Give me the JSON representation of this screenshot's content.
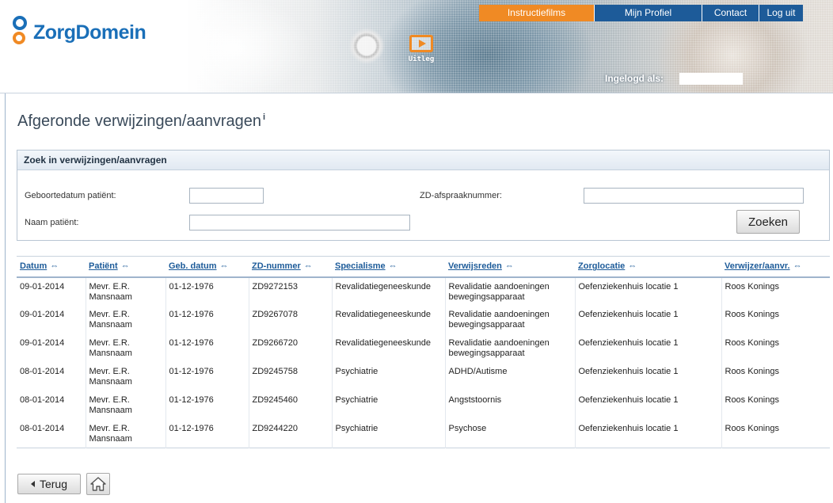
{
  "brand": {
    "name": "ZorgDomein"
  },
  "header": {
    "uitleg_label": "Uitleg",
    "nav": {
      "films": "Instructiefilms",
      "profiel": "Mijn Profiel",
      "contact": "Contact",
      "logout": "Log uit"
    },
    "logged_in_label": "Ingelogd als:"
  },
  "page": {
    "title": "Afgeronde verwijzingen/aanvragen",
    "info_marker": "i"
  },
  "search": {
    "heading": "Zoek in verwijzingen/aanvragen",
    "birthdate_label": "Geboortedatum patiënt:",
    "birthdate_value": "",
    "name_label": "Naam patiënt:",
    "name_value": "",
    "zd_label": "ZD-afspraaknummer:",
    "zd_value": "",
    "submit_label": "Zoeken"
  },
  "table": {
    "sort_glyph": "⇔",
    "headers": [
      "Datum",
      "Patiënt",
      "Geb. datum",
      "ZD-nummer",
      "Specialisme",
      "Verwijsreden",
      "Zorglocatie",
      "Verwijzer/aanvr."
    ],
    "rows": [
      [
        "09-01-2014",
        "Mevr. E.R. Mansnaam",
        "01-12-1976",
        "ZD9272153",
        "Revalidatiegeneeskunde",
        "Revalidatie aandoeningen bewegingsapparaat",
        "Oefenziekenhuis locatie 1",
        "Roos Konings"
      ],
      [
        "09-01-2014",
        "Mevr. E.R. Mansnaam",
        "01-12-1976",
        "ZD9267078",
        "Revalidatiegeneeskunde",
        "Revalidatie aandoeningen bewegingsapparaat",
        "Oefenziekenhuis locatie 1",
        "Roos Konings"
      ],
      [
        "09-01-2014",
        "Mevr. E.R. Mansnaam",
        "01-12-1976",
        "ZD9266720",
        "Revalidatiegeneeskunde",
        "Revalidatie aandoeningen bewegingsapparaat",
        "Oefenziekenhuis locatie 1",
        "Roos Konings"
      ],
      [
        "08-01-2014",
        "Mevr. E.R. Mansnaam",
        "01-12-1976",
        "ZD9245758",
        "Psychiatrie",
        "ADHD/Autisme",
        "Oefenziekenhuis locatie 1",
        "Roos Konings"
      ],
      [
        "08-01-2014",
        "Mevr. E.R. Mansnaam",
        "01-12-1976",
        "ZD9245460",
        "Psychiatrie",
        "Angststoornis",
        "Oefenziekenhuis locatie 1",
        "Roos Konings"
      ],
      [
        "08-01-2014",
        "Mevr. E.R. Mansnaam",
        "01-12-1976",
        "ZD9244220",
        "Psychiatrie",
        "Psychose",
        "Oefenziekenhuis locatie 1",
        "Roos Konings"
      ]
    ]
  },
  "footer": {
    "back_label": "Terug"
  },
  "colors": {
    "brand_blue": "#1a6fb8",
    "brand_orange": "#f08a24",
    "nav_blue": "#1d5b99",
    "link_blue": "#1d5b99"
  },
  "icons": {
    "home": "home-icon",
    "back": "chevron-left-icon",
    "play": "play-icon",
    "sort": "sort-icon"
  }
}
